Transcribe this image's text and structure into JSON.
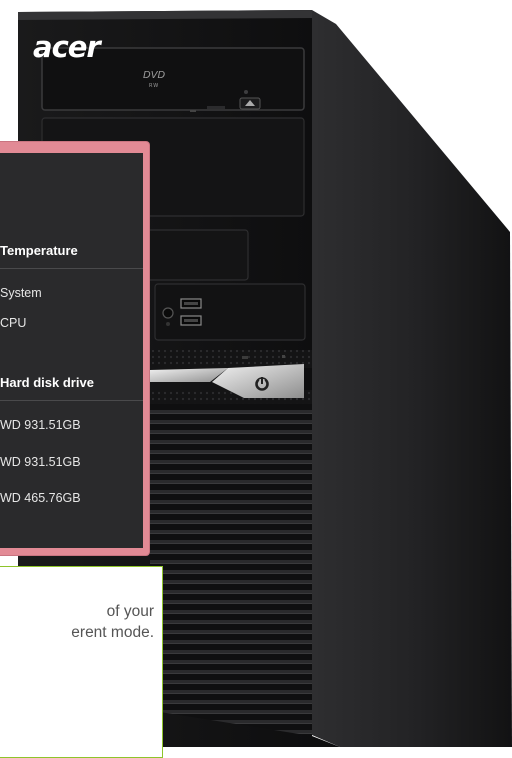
{
  "tower": {
    "brand": "acer",
    "drive_logo": "DVD",
    "drive_logo_sub": "RW",
    "power_icon": "power-icon"
  },
  "monitor": {
    "temperature": {
      "heading": "Temperature",
      "rows": [
        "System",
        "CPU"
      ]
    },
    "hdd": {
      "heading": "Hard disk drive",
      "rows": [
        "WD  931.51GB",
        "WD  931.51GB",
        "WD  465.76GB"
      ]
    }
  },
  "tip": {
    "line1": "of your",
    "line2": "erent mode."
  },
  "colors": {
    "panel_border": "#e28a95",
    "panel_bg": "#2a2a2c",
    "tip_border": "#8ec42a",
    "tower_body": "#1c1c1e"
  }
}
